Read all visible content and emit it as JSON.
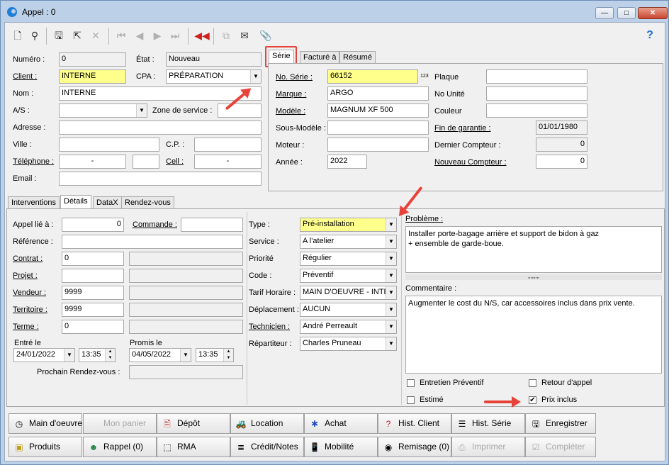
{
  "window": {
    "title": "Appel : 0",
    "minimize": "—",
    "maximize": "□",
    "close": "✕"
  },
  "toolbar": {
    "help": "?"
  },
  "header": {
    "numero": {
      "label": "Numéro :",
      "value": "0"
    },
    "etat": {
      "label": "État :",
      "value": "Nouveau"
    },
    "client": {
      "label": "Client :",
      "value": "INTERNE"
    },
    "cpa": {
      "label": "CPA :",
      "value": "PRÉPARATION"
    },
    "nom": {
      "label": "Nom :",
      "value": "INTERNE"
    },
    "as": {
      "label": "A/S :",
      "value": ""
    },
    "zone": {
      "label": "Zone de service :",
      "value": ""
    },
    "adresse": {
      "label": "Adresse :",
      "value": ""
    },
    "ville": {
      "label": "Ville :",
      "value": ""
    },
    "cp": {
      "label": "C.P. :",
      "value": ""
    },
    "telephone": {
      "label": "Téléphone :",
      "value": "-",
      "ext": ""
    },
    "cell": {
      "label": "Cell :",
      "value": "-"
    },
    "email": {
      "label": "Email :",
      "value": ""
    }
  },
  "serie_tabs": [
    "Série",
    "Facturé à",
    "Résumé"
  ],
  "serie": {
    "no_serie": {
      "label": "No. Série :",
      "value": "66152",
      "badge": "123"
    },
    "marque": {
      "label": "Marque :",
      "value": "ARGO"
    },
    "modele": {
      "label": "Modèle :",
      "value": "MAGNUM XF 500"
    },
    "sous_modele": {
      "label": "Sous-Modèle :",
      "value": ""
    },
    "moteur": {
      "label": "Moteur :",
      "value": ""
    },
    "annee": {
      "label": "Année :",
      "value": "2022"
    },
    "plaque": {
      "label": "Plaque",
      "value": ""
    },
    "no_unite": {
      "label": "No Unité",
      "value": ""
    },
    "couleur": {
      "label": "Couleur",
      "value": ""
    },
    "fin_garantie": {
      "label": "Fin de garantie :",
      "value": "01/01/1980"
    },
    "dernier_compteur": {
      "label": "Dernier Compteur :",
      "value": "0"
    },
    "nouveau_compteur": {
      "label": "Nouveau Compteur :",
      "value": "0"
    }
  },
  "lower_tabs": [
    "Interventions",
    "Détails",
    "DataX",
    "Rendez-vous"
  ],
  "details": {
    "appel_lie": {
      "label": "Appel lié à :",
      "value": "0"
    },
    "commande": {
      "label": "Commande :",
      "value": ""
    },
    "reference": {
      "label": "Référence :",
      "value": ""
    },
    "contrat": {
      "label": "Contrat :",
      "value": "0",
      "desc": ""
    },
    "projet": {
      "label": "Projet :",
      "value": "",
      "desc": ""
    },
    "vendeur": {
      "label": "Vendeur :",
      "value": "9999",
      "desc": ""
    },
    "territoire": {
      "label": "Territoire :",
      "value": "9999",
      "desc": ""
    },
    "terme": {
      "label": "Terme :",
      "value": "0",
      "desc": ""
    },
    "entre_le": {
      "label": "Entré le",
      "date": "24/01/2022",
      "time": "13:35"
    },
    "promis_le": {
      "label": "Promis le",
      "date": "04/05/2022",
      "time": "13:35"
    },
    "prochain_rdv": {
      "label": "Prochain Rendez-vous :",
      "value": ""
    }
  },
  "classification": {
    "type": {
      "label": "Type :",
      "value": "Pré-installation"
    },
    "service": {
      "label": "Service :",
      "value": "A l'atelier"
    },
    "priorite": {
      "label": "Priorité",
      "value": "Régulier"
    },
    "code": {
      "label": "Code :",
      "value": "Préventif"
    },
    "tarif": {
      "label": "Tarif Horaire :",
      "value": "MAIN D'OEUVRE - INTE"
    },
    "deplacement": {
      "label": "Déplacement :",
      "value": "AUCUN"
    },
    "technicien": {
      "label": "Technicien :",
      "value": "André Perreault"
    },
    "repartiteur": {
      "label": "Répartiteur :",
      "value": "Charles Pruneau"
    }
  },
  "notes": {
    "probleme_label": "Problème :",
    "probleme_text": "Installer porte-bagage arrière et support de bidon à gaz\n+ ensemble de garde-boue.",
    "splitter": "‚‚‚‚‚‚‚‚‚",
    "commentaire_label": "Commentaire :",
    "commentaire_text": "Augmenter le cost du N/S, car accessoires inclus dans prix vente."
  },
  "checkboxes": {
    "entretien": {
      "label": "Entretien Préventif",
      "checked": false
    },
    "retour": {
      "label": "Retour d'appel",
      "checked": false
    },
    "estime": {
      "label": "Estimé",
      "checked": false
    },
    "prix_inclus": {
      "label": "Prix inclus",
      "checked": true,
      "mark": "✔"
    }
  },
  "buttons_row1": [
    "Main d'oeuvre",
    "Mon panier",
    "Dépôt",
    "Location",
    "Achat",
    "Hist. Client",
    "Hist. Série",
    "Enregistrer"
  ],
  "buttons_row2": [
    "Produits",
    "Rappel (0)",
    "RMA",
    "Crédit/Notes",
    "Mobilité",
    "Remisage (0)",
    "Imprimer",
    "Compléter"
  ],
  "colors": {
    "highlight": "#ffff8c",
    "annotation": "#e8433a"
  }
}
